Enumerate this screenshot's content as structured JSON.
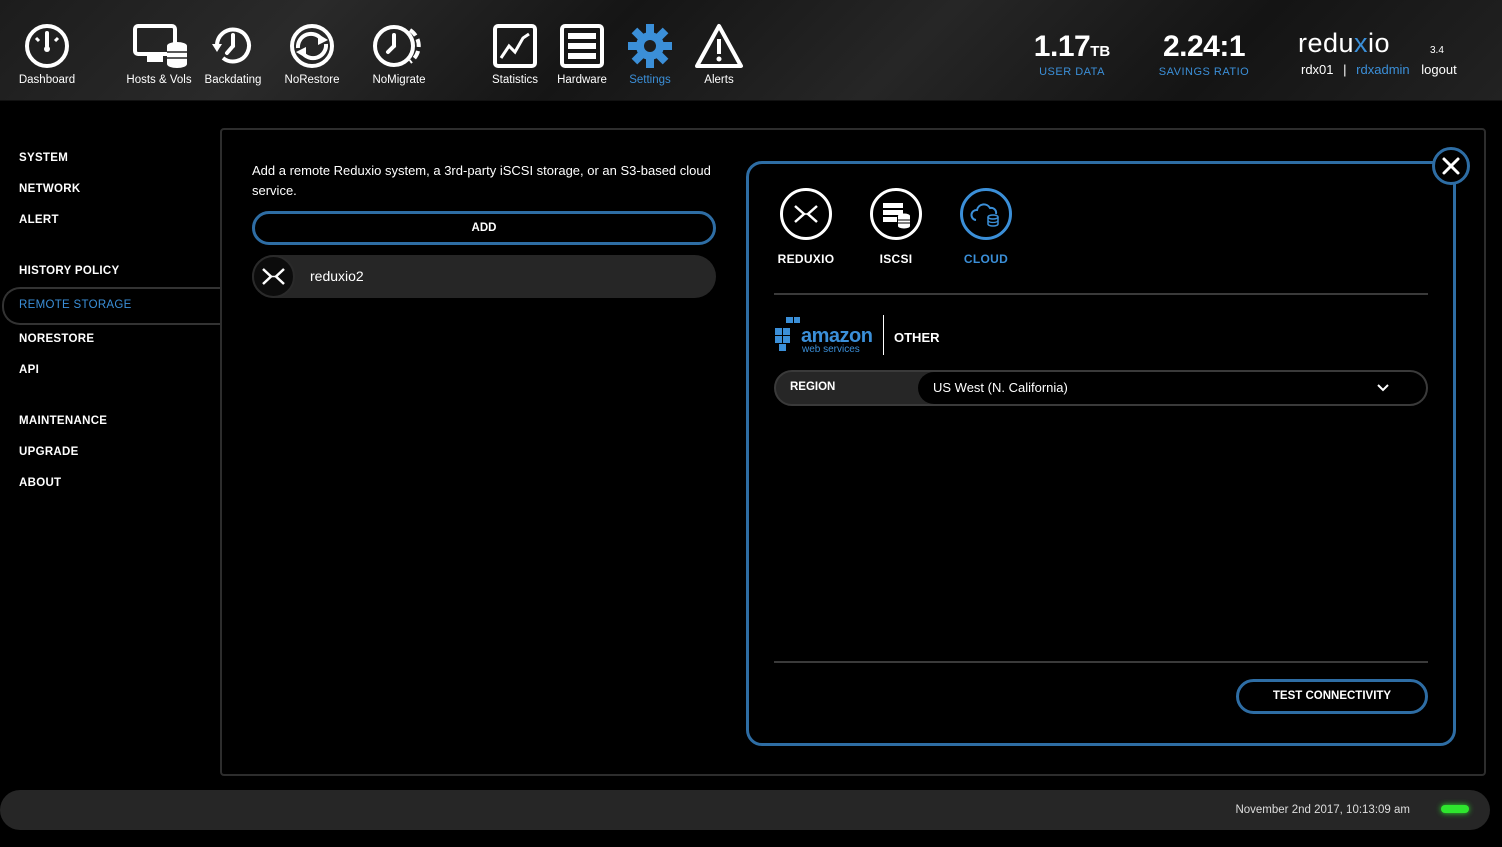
{
  "nav": {
    "dashboard": "Dashboard",
    "hosts_vols": "Hosts & Vols",
    "backdating": "Backdating",
    "norestore": "NoRestore",
    "nomigrate": "NoMigrate",
    "statistics": "Statistics",
    "hardware": "Hardware",
    "settings": "Settings",
    "alerts": "Alerts",
    "active": "Settings"
  },
  "stats": {
    "user_data_value": "1.17",
    "user_data_unit": "TB",
    "user_data_label": "USER DATA",
    "savings_value": "2.24:1",
    "savings_label": "SAVINGS RATIO"
  },
  "brand": {
    "prefix": "redu",
    "mark": "x",
    "suffix": "io",
    "version": "3.4",
    "system": "rdx01",
    "separator": "|",
    "user": "rdxadmin",
    "logout": "logout"
  },
  "sidebar": {
    "items": [
      "SYSTEM",
      "NETWORK",
      "ALERT",
      "HISTORY POLICY",
      "REMOTE STORAGE",
      "NORESTORE",
      "API",
      "MAINTENANCE",
      "UPGRADE",
      "ABOUT"
    ],
    "active": "REMOTE STORAGE"
  },
  "remote_storage": {
    "description": "Add a remote Reduxio system, a 3rd-party iSCSI storage, or an S3-based cloud service.",
    "add_label": "ADD",
    "systems": [
      {
        "name": "reduxio2",
        "icon": "reduxio-icon"
      }
    ]
  },
  "dialog": {
    "types": [
      "REDUXIO",
      "ISCSI",
      "CLOUD"
    ],
    "active_type": "CLOUD",
    "providers": {
      "amazon_main": "amazon",
      "amazon_sub": "web services",
      "other": "OTHER"
    },
    "region_label": "REGION",
    "region_value": "US West (N. California)",
    "test_label": "TEST CONNECTIVITY"
  },
  "footer": {
    "timestamp": "November 2nd 2017, 10:13:09 am",
    "status_color": "#2ee62e"
  },
  "colors": {
    "accent": "#3b8fd8",
    "border_accent": "#2e6da4"
  }
}
